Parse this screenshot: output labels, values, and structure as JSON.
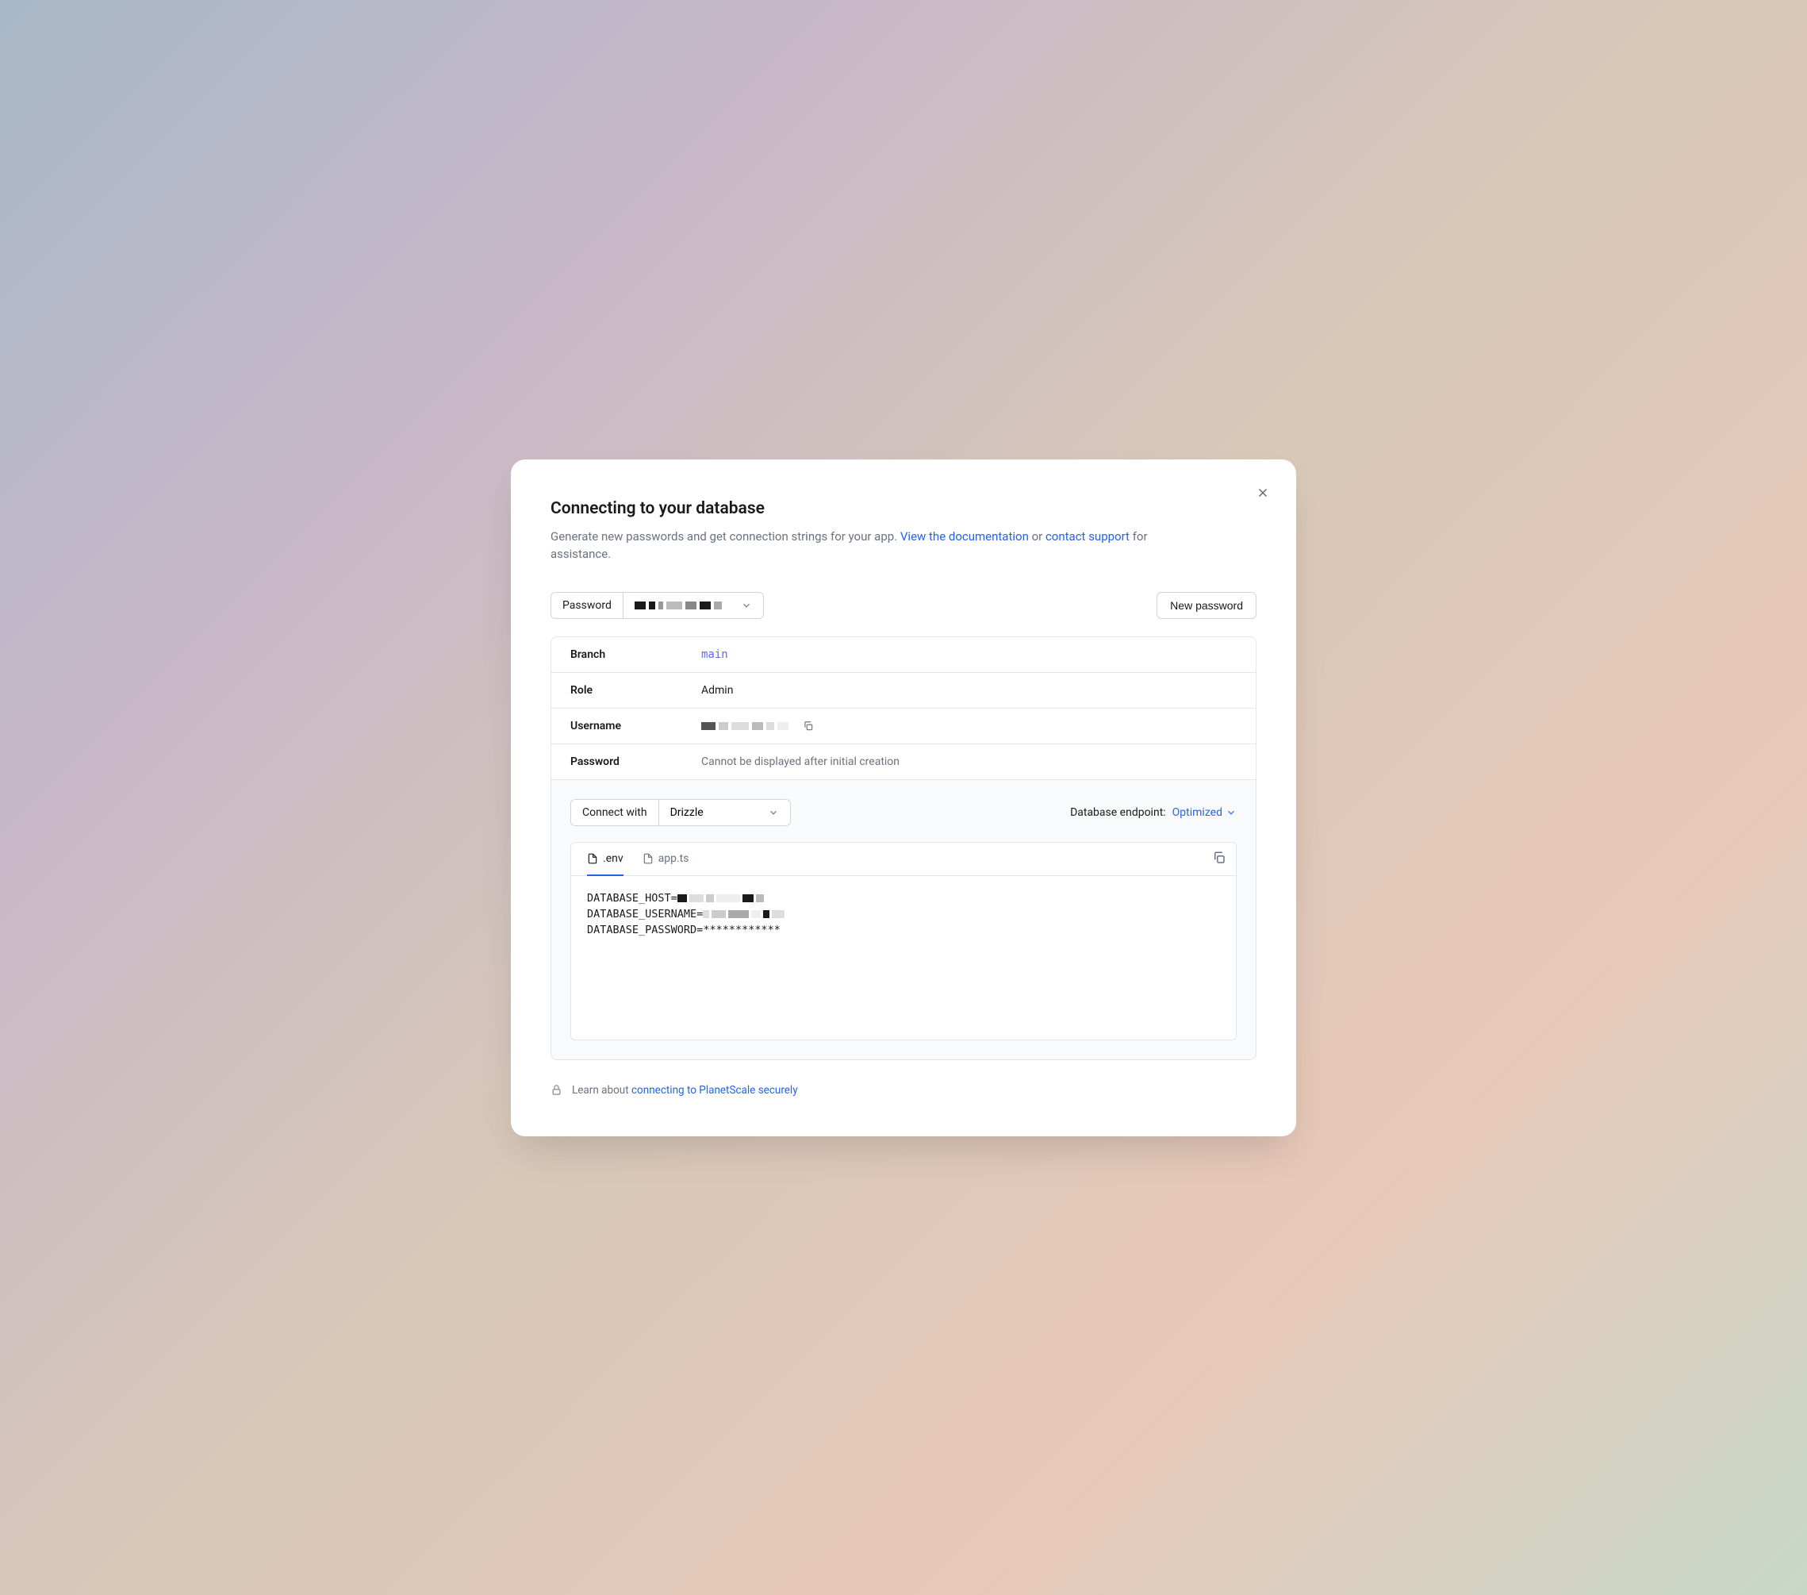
{
  "modal": {
    "title": "Connecting to your database",
    "subtitle_pre": "Generate new passwords and get connection strings for your app. ",
    "doc_link": "View the documentation",
    "subtitle_mid": " or ",
    "support_link": "contact support",
    "subtitle_post": " for assistance."
  },
  "toolbar": {
    "password_label": "Password",
    "new_password_label": "New password"
  },
  "details": {
    "branch_label": "Branch",
    "branch_value": "main",
    "role_label": "Role",
    "role_value": "Admin",
    "username_label": "Username",
    "password_label": "Password",
    "password_note": "Cannot be displayed after initial creation"
  },
  "connect": {
    "connect_with_label": "Connect with",
    "framework": "Drizzle",
    "endpoint_label": "Database endpoint:",
    "endpoint_value": "Optimized"
  },
  "tabs": {
    "env": ".env",
    "appts": "app.ts"
  },
  "env_lines": {
    "host_key": "DATABASE_HOST=",
    "user_key": "DATABASE_USERNAME=",
    "pass_key": "DATABASE_PASSWORD=",
    "pass_value": "************"
  },
  "footer": {
    "prefix": "Learn about ",
    "link": "connecting to PlanetScale securely"
  }
}
